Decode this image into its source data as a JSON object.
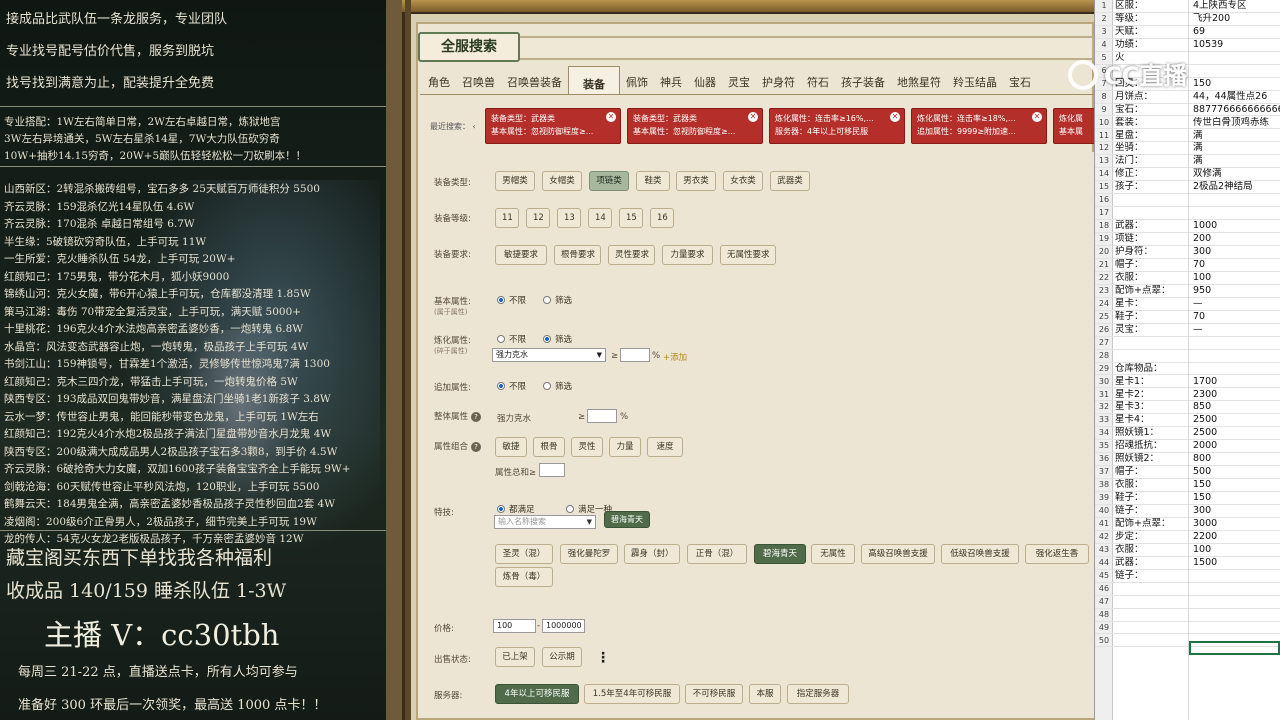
{
  "left_overlay": {
    "top_lines": [
      "接成品比武队伍一条龙服务，专业团队",
      "专业找号配号估价代售，服务到脱坑",
      "找号找到满意为止，配装提升全免费"
    ],
    "info_lines": [
      "专业搭配：1W左右简单日常，2W左右卓越日常，炼狱地宫",
      "3W左右异境通关，5W左右星杀14星，7W大力队伍砍穷奇",
      "10W+抽秒14.15穷奇，20W+5巅队伍轻轻松松一刀砍刷本！！"
    ],
    "list_lines": [
      "山西新区：2转混杀搬砖组号，宝石多多 25天赋百万师徒积分 5500",
      "齐云灵脉：159混杀亿光14星队伍 4.6W",
      "齐云灵脉：170混杀 卓越日常组号 6.7W",
      "半生缘：5破镜砍穷奇队伍，上手可玩 11W",
      "一生所爱：克火睡杀队伍 54龙，上手可玩 20W+",
      "红颜知己：175男鬼，带分花木月，狐小妖9000",
      "锦绣山河：克火女魔，带6开心猿上手可玩，仓库都没清理 1.85W",
      "策马江湖：毒伤 70带宠全复活灵宝，上手可玩，满天赋 5000+",
      "十里桃花：196克火4介水法炮高亲密孟婆妙香，一炮转鬼 6.8W",
      "水晶宫：风法变态武器容止炮，一炮转鬼，极品孩子上手可玩 4W",
      "书剑江山：159神锁号，甘霖差1个激活，灵修够传世惊鸿鬼7满 1300",
      "红颜知己：克木三四介龙，带猛击上手可玩，一炮转鬼价格 5W",
      "陕西专区：193成品双回鬼带妙音，满星盘法门坐骑1老1新孩子 3.8W",
      "云水一梦：传世容止男鬼，能回能秒带变色龙鬼，上手可玩 1W左右",
      "红颜知己：192克火4介水炮2极品孩子满法门星盘带妙音水月龙鬼 4W",
      "陕西专区：200级满大成成品男人2极品孩子宝石多3颗8，到手价 4.5W",
      "齐云灵脉：6破抢奇大力女魔，双加1600孩子装备宝宝齐全上手能玩 9W+",
      "剑戟沧海：60天赋传世容止平秒风法炮，120职业，上手可玩 5500",
      "鹤舞云天：184男鬼全满，高亲密孟婆妙香极品孩子灵性秒回血2套 4W",
      "凌烟阁：200级6介正骨男人，2极品孩子，细节完美上手可玩 19W",
      "龙的传人：54克火女龙2老版极品孩子，千万亲密孟婆妙音 12W"
    ],
    "promo1": "藏宝阁买东西下单找我各种福利",
    "promo2": "收成品 140/159 睡杀队伍 1-3W",
    "anchor": "主播 V：cc30tbh",
    "weekly": "每周三 21-22 点，直播送点卡，所有人均可参与",
    "prize": "准备好 300 环最后一次领奖，最高送 1000 点卡！！"
  },
  "game": {
    "title": "全服搜索",
    "tabs": [
      "角色",
      "召唤兽",
      "召唤兽装备",
      "装备",
      "佩饰",
      "神兵",
      "仙器",
      "灵宝",
      "护身符",
      "符石",
      "孩子装备",
      "地煞星符",
      "羚玉结晶",
      "宝石"
    ],
    "active_tab": "装备",
    "recent_label": "最近搜索：",
    "recent_arrow": "‹",
    "recent": [
      {
        "l1": "装备类型：武器类",
        "l2": "基本属性：忽视防御程度≥..."
      },
      {
        "l1": "装备类型：武器类",
        "l2": "基本属性：忽视防御程度≥..."
      },
      {
        "l1": "炼化属性：连击率≥16%,...",
        "l2": "服务器：4年以上可移民服"
      },
      {
        "l1": "炼化属性：连击率≥18%,...",
        "l2": "追加属性：9999≥附加速..."
      },
      {
        "l1": "炼化属",
        "l2": "基本属"
      }
    ],
    "close_glyph": "✕",
    "equip_type_label": "装备类型:",
    "equip_types": [
      "男帽类",
      "女帽类",
      "项链类",
      "鞋类",
      "男衣类",
      "女衣类",
      "武器类"
    ],
    "equip_type_selected": "项链类",
    "level_label": "装备等级:",
    "levels": [
      "11",
      "12",
      "13",
      "14",
      "15",
      "16"
    ],
    "req_label": "装备要求:",
    "reqs": [
      "敏捷要求",
      "根骨要求",
      "灵性要求",
      "力量要求",
      "无属性要求"
    ],
    "base_label": "基本属性:",
    "base_sub": "(属于属性)",
    "opt_unlimited": "不限",
    "opt_filter": "筛选",
    "refine_label": "炼化属性:",
    "refine_sub": "(碎于属性)",
    "refine_select": "强力克水",
    "refine_ge": "≥",
    "refine_pct": "%",
    "refine_add": "+添加",
    "extra_label": "追加属性:",
    "overall_label": "整体属性",
    "overall_item": "强力克水",
    "overall_ge": "≥",
    "overall_pct": "%",
    "combo_label": "属性组合",
    "combo_items": [
      "敏捷",
      "根骨",
      "灵性",
      "力量",
      "速度"
    ],
    "combo_sum": "属性总和≥",
    "skill_label": "特技:",
    "skill_all": "都满足",
    "skill_one": "满足一种",
    "skill_input_placeholder": "输入名称搜索",
    "skill_chip": "碧海青天",
    "skills": [
      "圣灵（混）",
      "强化曼陀罗",
      "霹身（封）",
      "正骨（混）",
      "碧海青天",
      "无属性",
      "高级召唤兽支援",
      "低级召唤兽支援",
      "强化返生香",
      "炼骨（毒）"
    ],
    "skill_selected": "碧海青天",
    "price_label": "价格:",
    "price_min": "100",
    "price_dash": "-",
    "price_max": "1000000",
    "sale_label": "出售状态:",
    "sale_opts": [
      "已上架",
      "公示期"
    ],
    "more_glyph": "⋮",
    "server_label": "服务器:",
    "servers": [
      "4年以上可移民服",
      "1.5年至4年可移民服",
      "不可移民服",
      "本服",
      "指定服务器"
    ],
    "server_selected": "4年以上可移民服"
  },
  "logo": "CC直播",
  "sheet": {
    "rows": [
      {
        "n": "1",
        "a": "区服：",
        "b": "4上陕西专区"
      },
      {
        "n": "2",
        "a": "等级：",
        "b": "飞升200"
      },
      {
        "n": "3",
        "a": "天赋：",
        "b": "69"
      },
      {
        "n": "4",
        "a": "功绩：",
        "b": "10539"
      },
      {
        "n": "5",
        "a": "火",
        "b": ""
      },
      {
        "n": "6",
        "a": "",
        "b": ""
      },
      {
        "n": "7",
        "a": "回灵：",
        "b": "150"
      },
      {
        "n": "8",
        "a": "月饼点：",
        "b": "44，44属性点26"
      },
      {
        "n": "9",
        "a": "宝石：",
        "b": "8877766666666666"
      },
      {
        "n": "10",
        "a": "套装：",
        "b": "传世白骨顶鸡赤练"
      },
      {
        "n": "11",
        "a": "星盘：",
        "b": "满"
      },
      {
        "n": "12",
        "a": "坐骑：",
        "b": "满"
      },
      {
        "n": "13",
        "a": "法门：",
        "b": "满"
      },
      {
        "n": "14",
        "a": "修正：",
        "b": "双修满"
      },
      {
        "n": "15",
        "a": "孩子：",
        "b": "2极品2神结局"
      },
      {
        "n": "16",
        "a": "",
        "b": ""
      },
      {
        "n": "17",
        "a": "",
        "b": ""
      },
      {
        "n": "18",
        "a": "武器：",
        "b": "1000"
      },
      {
        "n": "19",
        "a": "项链：",
        "b": "200"
      },
      {
        "n": "20",
        "a": "护身符：",
        "b": "300"
      },
      {
        "n": "21",
        "a": "帽子：",
        "b": "70"
      },
      {
        "n": "22",
        "a": "衣服：",
        "b": "100"
      },
      {
        "n": "23",
        "a": "配饰+点翠：",
        "b": "950"
      },
      {
        "n": "24",
        "a": "星卡：",
        "b": "—"
      },
      {
        "n": "25",
        "a": "鞋子：",
        "b": "70"
      },
      {
        "n": "26",
        "a": "灵宝：",
        "b": "—"
      },
      {
        "n": "27",
        "a": "",
        "b": ""
      },
      {
        "n": "28",
        "a": "",
        "b": ""
      },
      {
        "n": "29",
        "a": "仓库物品：",
        "b": ""
      },
      {
        "n": "30",
        "a": "星卡1：",
        "b": "1700"
      },
      {
        "n": "31",
        "a": "星卡2：",
        "b": "2300"
      },
      {
        "n": "32",
        "a": "星卡3：",
        "b": "850"
      },
      {
        "n": "33",
        "a": "星卡4：",
        "b": "2500"
      },
      {
        "n": "34",
        "a": "照妖镜1：",
        "b": "2500"
      },
      {
        "n": "35",
        "a": "招魂抵抗：",
        "b": "2000"
      },
      {
        "n": "36",
        "a": "照妖镜2：",
        "b": "800"
      },
      {
        "n": "37",
        "a": "帽子：",
        "b": "500"
      },
      {
        "n": "38",
        "a": "衣服：",
        "b": "150"
      },
      {
        "n": "39",
        "a": "鞋子：",
        "b": "150"
      },
      {
        "n": "40",
        "a": "链子：",
        "b": "300"
      },
      {
        "n": "41",
        "a": "配饰+点翠：",
        "b": "3000"
      },
      {
        "n": "42",
        "a": "步定：",
        "b": "2200"
      },
      {
        "n": "43",
        "a": "衣服：",
        "b": "100"
      },
      {
        "n": "44",
        "a": "武器：",
        "b": "1500"
      },
      {
        "n": "45",
        "a": "链子：",
        "b": ""
      },
      {
        "n": "46",
        "a": "",
        "b": ""
      },
      {
        "n": "47",
        "a": "",
        "b": ""
      },
      {
        "n": "48",
        "a": "",
        "b": ""
      },
      {
        "n": "49",
        "a": "",
        "b": ""
      },
      {
        "n": "50",
        "a": "",
        "b": ""
      }
    ]
  }
}
